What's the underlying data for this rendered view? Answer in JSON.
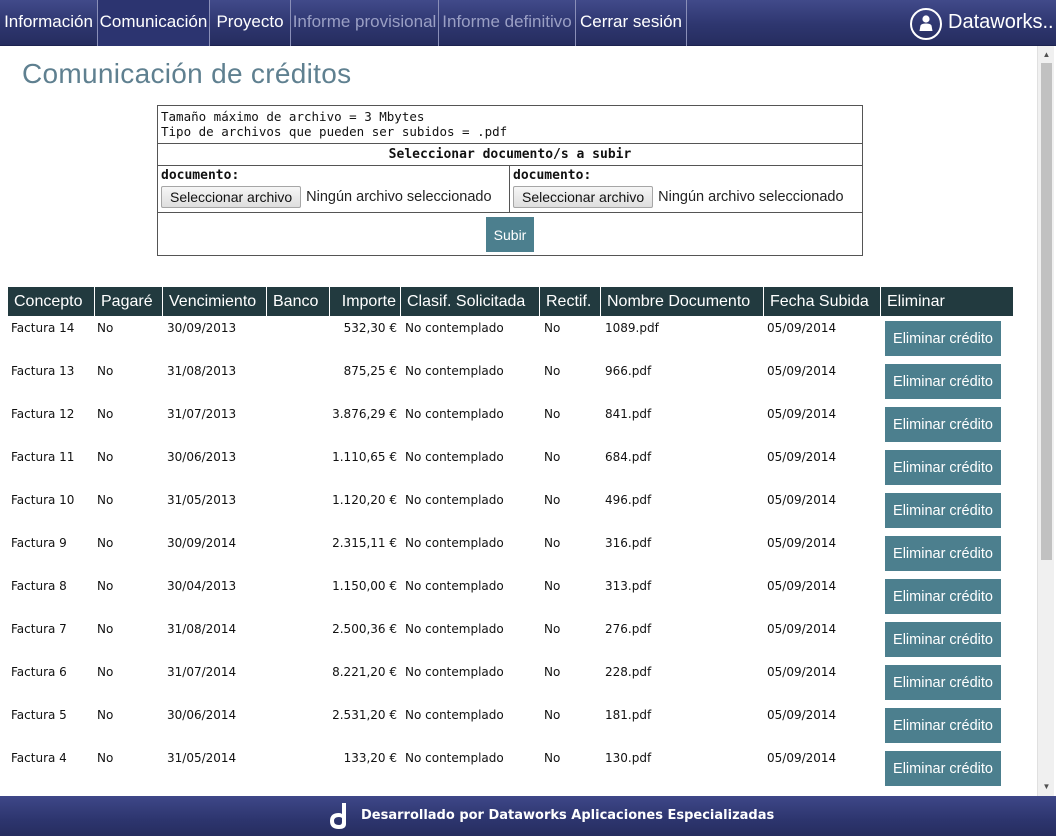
{
  "nav": {
    "items": [
      {
        "label": "Información"
      },
      {
        "label": "Comunicación"
      },
      {
        "label": "Proyecto"
      },
      {
        "label": "Informe provisional"
      },
      {
        "label": "Informe definitivo"
      },
      {
        "label": "Cerrar sesión"
      }
    ],
    "brand": "Dataworks..",
    "colors": {
      "bar": "#2e366f",
      "active": "#2c3470",
      "disabled_text": "#9a9fc4"
    }
  },
  "page": {
    "title": "Comunicación de créditos"
  },
  "upload": {
    "max_size_text": "Tamaño máximo de archivo = 3 Mbytes",
    "types_text": "Tipo de archivos que pueden ser subidos = .pdf",
    "header": "Seleccionar documento/s a subir",
    "fields": [
      {
        "label": "documento:",
        "button": "Seleccionar archivo",
        "status": "Ningún archivo seleccionado"
      },
      {
        "label": "documento:",
        "button": "Seleccionar archivo",
        "status": "Ningún archivo seleccionado"
      }
    ],
    "submit_label": "Subir"
  },
  "table": {
    "columns": [
      "Concepto",
      "Pagaré",
      "Vencimiento",
      "Banco",
      "Importe",
      "Clasif. Solicitada",
      "Rectif.",
      "Nombre Documento",
      "Fecha Subida",
      "Eliminar"
    ],
    "header_color": "#223a3f",
    "button_color": "#4c7f8e",
    "rows": [
      {
        "concepto": "Factura 14",
        "pagare": "No",
        "vencimiento": "30/09/2013",
        "banco": "",
        "importe": "532,30 €",
        "clasif": "No contemplado",
        "rectif": "No",
        "documento": "1089.pdf",
        "fecha": "05/09/2014",
        "eliminar": "Eliminar crédito"
      },
      {
        "concepto": "Factura 13",
        "pagare": "No",
        "vencimiento": "31/08/2013",
        "banco": "",
        "importe": "875,25 €",
        "clasif": "No contemplado",
        "rectif": "No",
        "documento": "966.pdf",
        "fecha": "05/09/2014",
        "eliminar": "Eliminar crédito"
      },
      {
        "concepto": "Factura 12",
        "pagare": "No",
        "vencimiento": "31/07/2013",
        "banco": "",
        "importe": "3.876,29 €",
        "clasif": "No contemplado",
        "rectif": "No",
        "documento": "841.pdf",
        "fecha": "05/09/2014",
        "eliminar": "Eliminar crédito"
      },
      {
        "concepto": "Factura 11",
        "pagare": "No",
        "vencimiento": "30/06/2013",
        "banco": "",
        "importe": "1.110,65 €",
        "clasif": "No contemplado",
        "rectif": "No",
        "documento": "684.pdf",
        "fecha": "05/09/2014",
        "eliminar": "Eliminar crédito"
      },
      {
        "concepto": "Factura 10",
        "pagare": "No",
        "vencimiento": "31/05/2013",
        "banco": "",
        "importe": "1.120,20 €",
        "clasif": "No contemplado",
        "rectif": "No",
        "documento": "496.pdf",
        "fecha": "05/09/2014",
        "eliminar": "Eliminar crédito"
      },
      {
        "concepto": "Factura 9",
        "pagare": "No",
        "vencimiento": "30/09/2014",
        "banco": "",
        "importe": "2.315,11 €",
        "clasif": "No contemplado",
        "rectif": "No",
        "documento": "316.pdf",
        "fecha": "05/09/2014",
        "eliminar": "Eliminar crédito"
      },
      {
        "concepto": "Factura 8",
        "pagare": "No",
        "vencimiento": "30/04/2013",
        "banco": "",
        "importe": "1.150,00 €",
        "clasif": "No contemplado",
        "rectif": "No",
        "documento": "313.pdf",
        "fecha": "05/09/2014",
        "eliminar": "Eliminar crédito"
      },
      {
        "concepto": "Factura 7",
        "pagare": "No",
        "vencimiento": "31/08/2014",
        "banco": "",
        "importe": "2.500,36 €",
        "clasif": "No contemplado",
        "rectif": "No",
        "documento": "276.pdf",
        "fecha": "05/09/2014",
        "eliminar": "Eliminar crédito"
      },
      {
        "concepto": "Factura 6",
        "pagare": "No",
        "vencimiento": "31/07/2014",
        "banco": "",
        "importe": "8.221,20 €",
        "clasif": "No contemplado",
        "rectif": "No",
        "documento": "228.pdf",
        "fecha": "05/09/2014",
        "eliminar": "Eliminar crédito"
      },
      {
        "concepto": "Factura 5",
        "pagare": "No",
        "vencimiento": "30/06/2014",
        "banco": "",
        "importe": "2.531,20 €",
        "clasif": "No contemplado",
        "rectif": "No",
        "documento": "181.pdf",
        "fecha": "05/09/2014",
        "eliminar": "Eliminar crédito"
      },
      {
        "concepto": "Factura 4",
        "pagare": "No",
        "vencimiento": "31/05/2014",
        "banco": "",
        "importe": "133,20 €",
        "clasif": "No contemplado",
        "rectif": "No",
        "documento": "130.pdf",
        "fecha": "05/09/2014",
        "eliminar": "Eliminar crédito"
      }
    ]
  },
  "footer": {
    "text": "Desarrollado por Dataworks Aplicaciones Especializadas",
    "logo_icon": "dataworks-logo-icon"
  }
}
